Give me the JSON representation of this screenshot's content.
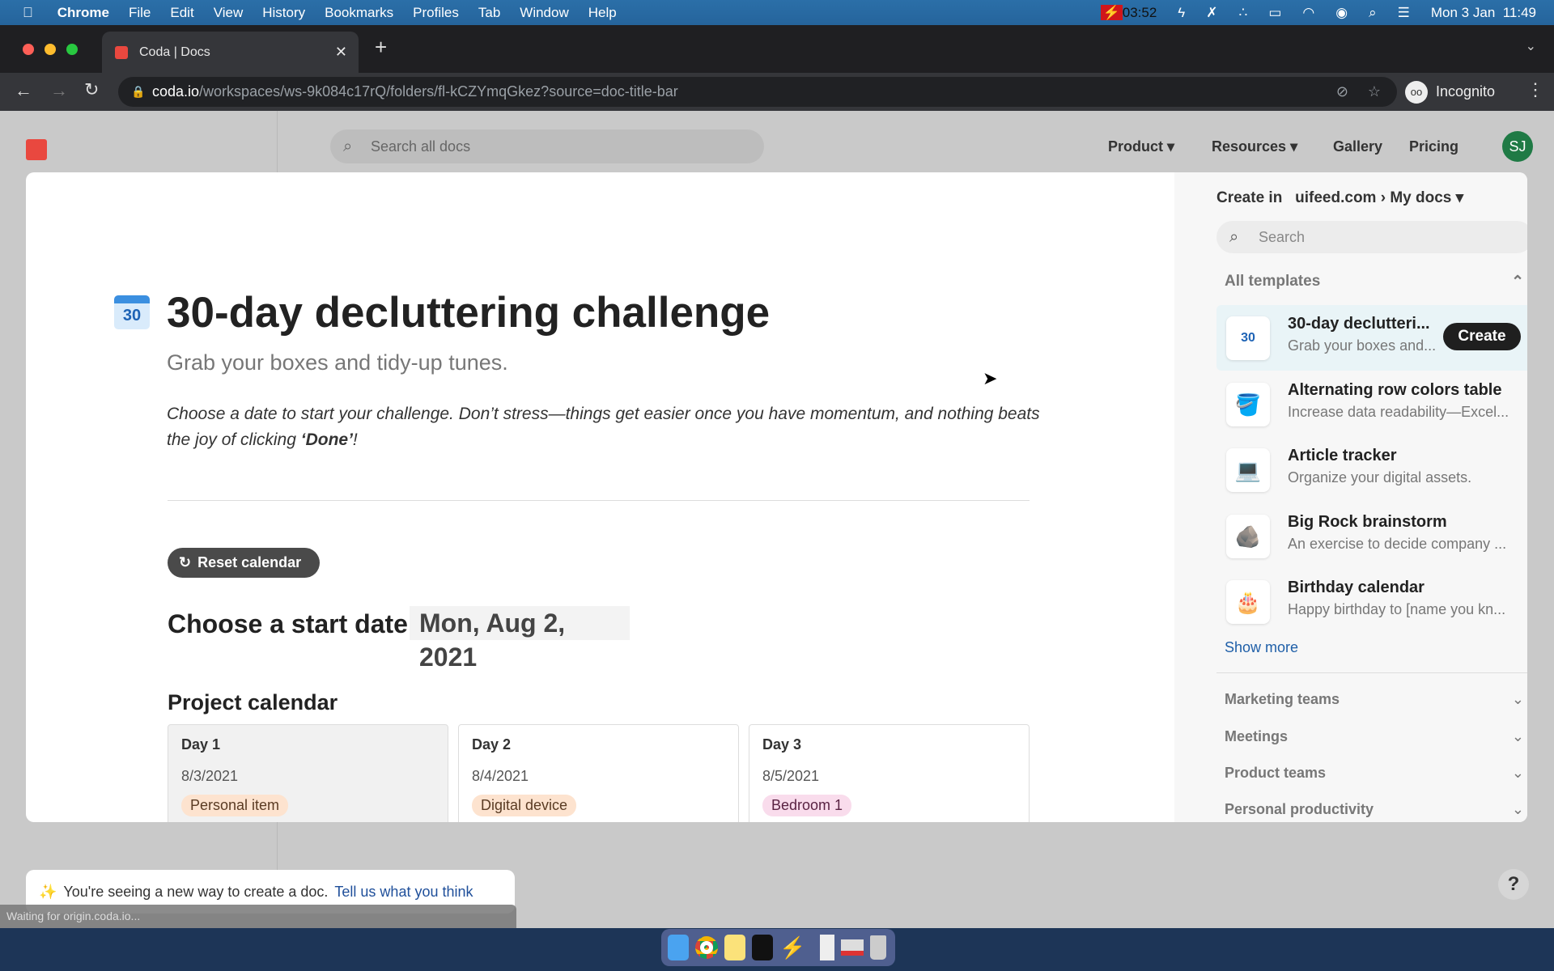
{
  "menubar": {
    "app": "Chrome",
    "items": [
      "File",
      "Edit",
      "View",
      "History",
      "Bookmarks",
      "Profiles",
      "Tab",
      "Window",
      "Help"
    ],
    "timer": "03:52",
    "datetime": "Mon 3 Jan  11:49"
  },
  "browser": {
    "tab_title": "Coda | Docs",
    "url_host": "coda.io",
    "url_path": "/workspaces/ws-9k084c17rQ/folders/fl-kCZYmqGkez?source=doc-title-bar",
    "profile": "Incognito",
    "status": "Waiting for origin.coda.io..."
  },
  "header": {
    "search_placeholder": "Search all docs",
    "nav": [
      "Product",
      "Resources",
      "Gallery",
      "Pricing"
    ],
    "avatar": "SJ",
    "accent": "#2e9e5b"
  },
  "doc": {
    "icon_number": "30",
    "title": "30-day decluttering challenge",
    "subtitle": "Grab your boxes and tidy-up tunes.",
    "intro": "Choose a date to start your challenge. Don’t stress—things get easier once you have momentum, and nothing beats the joy of clicking ",
    "intro_bold": "‘Done’",
    "intro_end": "!",
    "reset_label": "Reset calendar",
    "start_label": "Choose a start date:",
    "start_value": "Mon, Aug 2, 2021",
    "calendar_heading": "Project calendar",
    "days": [
      {
        "day": "Day 1",
        "date": "8/3/2021",
        "tag": "Personal item",
        "color": "#fde3cf"
      },
      {
        "day": "Day 2",
        "date": "8/4/2021",
        "tag": "Digital device",
        "color": "#fde3cf"
      },
      {
        "day": "Day 3",
        "date": "8/5/2021",
        "tag": "Bedroom 1",
        "color": "#f9dcec"
      }
    ]
  },
  "panel": {
    "create_in": "Create in",
    "workspace": "uifeed.com",
    "folder": "My docs",
    "search_placeholder": "Search",
    "section": "All templates",
    "create_button": "Create",
    "templates": [
      {
        "name": "30-day declutteri...",
        "desc": "Grab your boxes and...",
        "icon": "calendar-icon"
      },
      {
        "name": "Alternating row colors table",
        "desc": "Increase data readability—Excel...",
        "icon": "paint-bucket-icon"
      },
      {
        "name": "Article tracker",
        "desc": "Organize your digital assets.",
        "icon": "laptop-icon"
      },
      {
        "name": "Big Rock brainstorm",
        "desc": "An exercise to decide company ...",
        "icon": "rock-icon"
      },
      {
        "name": "Birthday calendar",
        "desc": "Happy birthday to [name you kn...",
        "icon": "cake-icon"
      }
    ],
    "show_more": "Show more",
    "categories": [
      "Marketing teams",
      "Meetings",
      "Product teams",
      "Personal productivity"
    ]
  },
  "toast": {
    "text": "You're seeing a new way to create a doc.",
    "link": "Tell us what you think"
  },
  "help": "?"
}
